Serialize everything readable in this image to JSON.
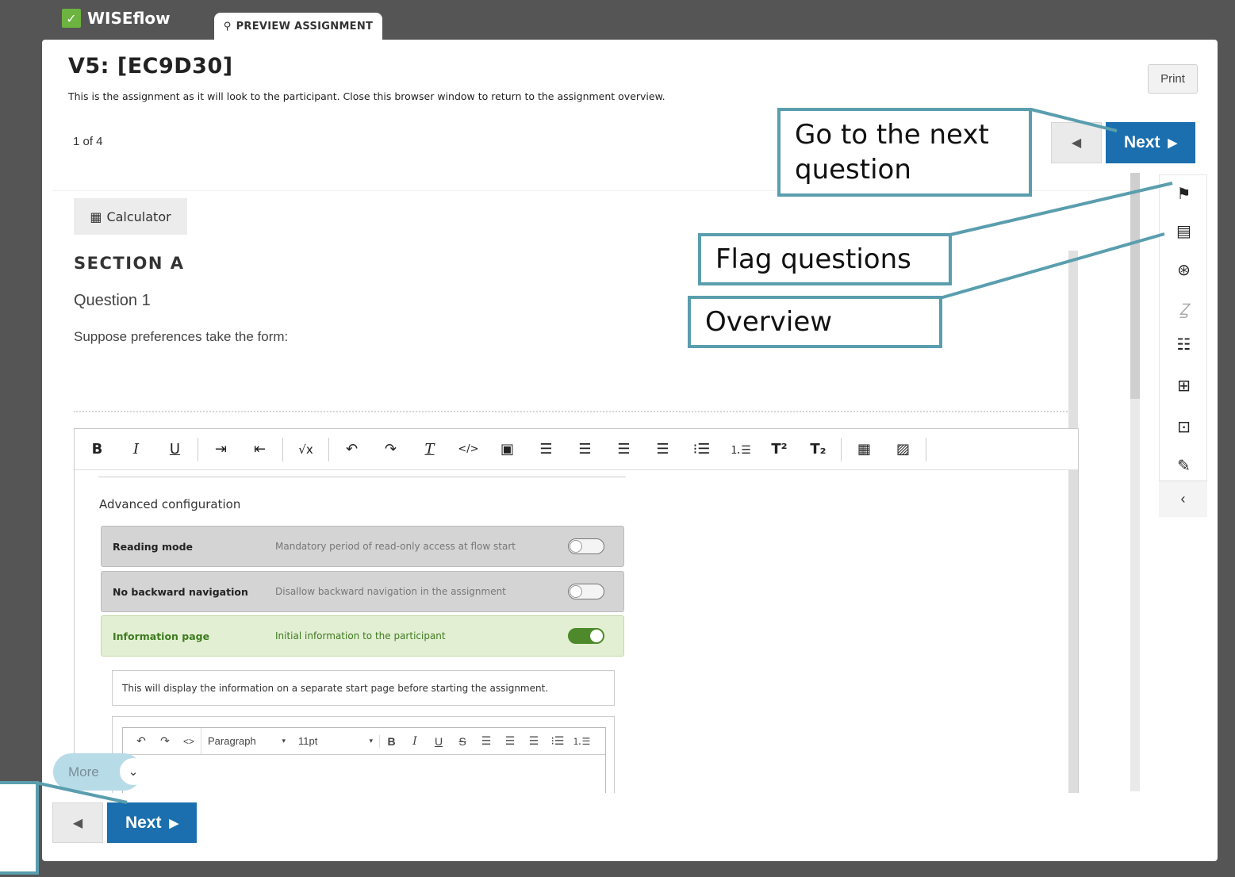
{
  "app": {
    "logo_text": "WISEflow",
    "preview_tab": "PREVIEW ASSIGNMENT"
  },
  "header": {
    "title": "V5: [EC9D30]",
    "subtitle": "This is the assignment as it will look to the participant. Close this browser window to return to the assignment overview.",
    "print_label": "Print"
  },
  "nav": {
    "counter": "1 of 4",
    "next_label": "Next",
    "prev_icon": "◀",
    "next_icon": "▶"
  },
  "content": {
    "calculator_label": "Calculator",
    "section_heading": "SECTION A",
    "question_label": "Question 1",
    "question_text": "Suppose preferences take the form:"
  },
  "editor": {
    "toolbar": [
      "B",
      "I",
      "U",
      "indent",
      "outdent",
      "√x",
      "undo",
      "redo",
      "clear-format",
      "code",
      "source",
      "align-left",
      "align-center",
      "align-right",
      "justify",
      "bullet-list",
      "numbered-list",
      "superscript",
      "subscript",
      "table",
      "image"
    ],
    "advanced_title": "Advanced configuration",
    "config_rows": [
      {
        "name": "Reading mode",
        "description": "Mandatory period of read-only access at flow start",
        "enabled": false
      },
      {
        "name": "No backward navigation",
        "description": "Disallow backward navigation in the assignment",
        "enabled": false
      },
      {
        "name": "Information page",
        "description": "Initial information to the participant",
        "enabled": true
      }
    ],
    "info_text": "This will display the information on a separate start page before starting the assignment.",
    "inner_toolbar": {
      "block_format": "Paragraph",
      "font_size": "11pt"
    }
  },
  "more": {
    "label": "More"
  },
  "side_tools": [
    "flag-icon",
    "overview-icon",
    "accessibility-icon",
    "translate-icon",
    "notes-icon",
    "add-note-icon",
    "review-icon",
    "pen-icon"
  ],
  "annotations": {
    "next": "Go to the next question",
    "flag": "Flag questions",
    "overview": "Overview"
  },
  "colors": {
    "primary": "#1b6fae",
    "annotation_border": "#5a9eae",
    "active_green": "#4e8a2b",
    "frame": "#555555"
  }
}
